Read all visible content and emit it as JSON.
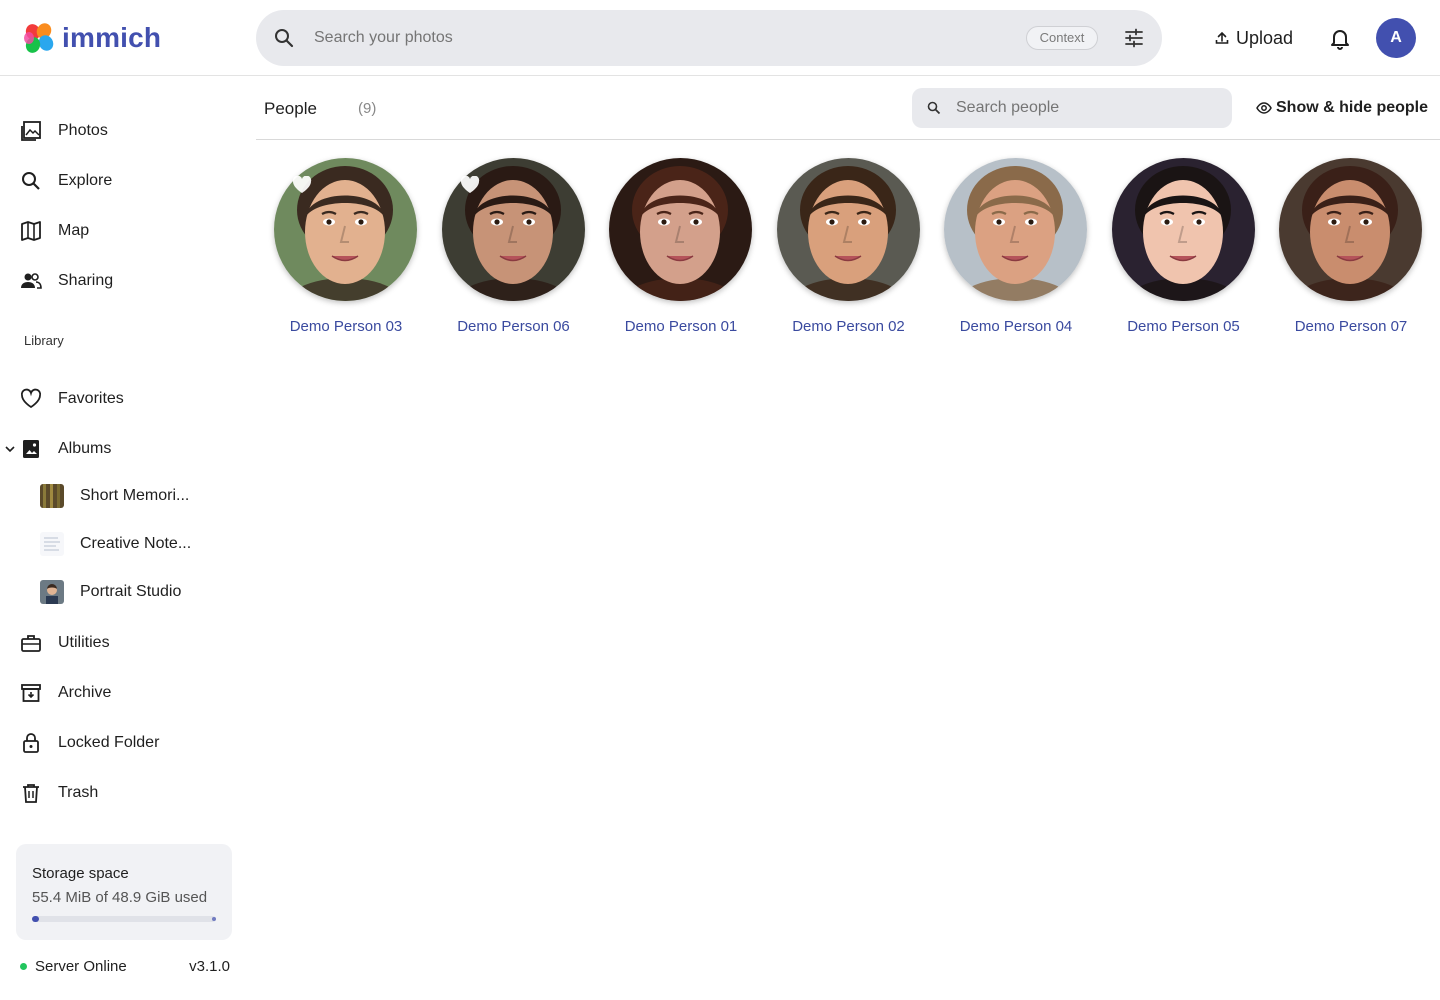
{
  "app": {
    "name": "immich"
  },
  "header": {
    "search_placeholder": "Search your photos",
    "context_label": "Context",
    "upload_label": "Upload",
    "avatar_initial": "A"
  },
  "sidebar": {
    "items": [
      {
        "label": "Photos",
        "icon": "photos-icon"
      },
      {
        "label": "Explore",
        "icon": "search-icon"
      },
      {
        "label": "Map",
        "icon": "map-icon"
      },
      {
        "label": "Sharing",
        "icon": "people-icon"
      }
    ],
    "library_label": "Library",
    "library_items": [
      {
        "label": "Favorites",
        "icon": "heart-icon"
      },
      {
        "label": "Albums",
        "icon": "album-icon"
      }
    ],
    "albums": [
      {
        "label": "Short Memori..."
      },
      {
        "label": "Creative Note..."
      },
      {
        "label": "Portrait Studio"
      }
    ],
    "more_items": [
      {
        "label": "Utilities",
        "icon": "toolbox-icon"
      },
      {
        "label": "Archive",
        "icon": "archive-icon"
      },
      {
        "label": "Locked Folder",
        "icon": "lock-icon"
      },
      {
        "label": "Trash",
        "icon": "trash-icon"
      }
    ],
    "storage": {
      "title": "Storage space",
      "usage": "55.4 MiB of 48.9 GiB used",
      "used_fraction": 0.04
    },
    "server": {
      "status": "Server Online",
      "version": "v3.1.0"
    }
  },
  "main": {
    "title": "People",
    "count": "(9)",
    "search_placeholder": "Search people",
    "show_hide_label": "Show & hide people",
    "people": [
      {
        "name": "Demo Person 03",
        "favorite": true,
        "skin": "#e2b18f",
        "hair": "#3a2a20",
        "bg": "#6f8a5e"
      },
      {
        "name": "Demo Person 06",
        "favorite": true,
        "skin": "#c79377",
        "hair": "#2a1a14",
        "bg": "#3d3d33"
      },
      {
        "name": "Demo Person 01",
        "favorite": false,
        "skin": "#d3a08b",
        "hair": "#4a2418",
        "bg": "#2b1a14"
      },
      {
        "name": "Demo Person 02",
        "favorite": false,
        "skin": "#d9a07c",
        "hair": "#3a2618",
        "bg": "#5a5a52"
      },
      {
        "name": "Demo Person 04",
        "favorite": false,
        "skin": "#dba182",
        "hair": "#8a6a4a",
        "bg": "#b7c0c8"
      },
      {
        "name": "Demo Person 05",
        "favorite": false,
        "skin": "#f0c4ae",
        "hair": "#1a1414",
        "bg": "#2a2230"
      },
      {
        "name": "Demo Person 07",
        "favorite": false,
        "skin": "#c98d6e",
        "hair": "#3a2018",
        "bg": "#4a3a30"
      }
    ]
  },
  "colors": {
    "accent": "#4250af",
    "online": "#22c55e",
    "name_link": "#3a4a9f"
  }
}
